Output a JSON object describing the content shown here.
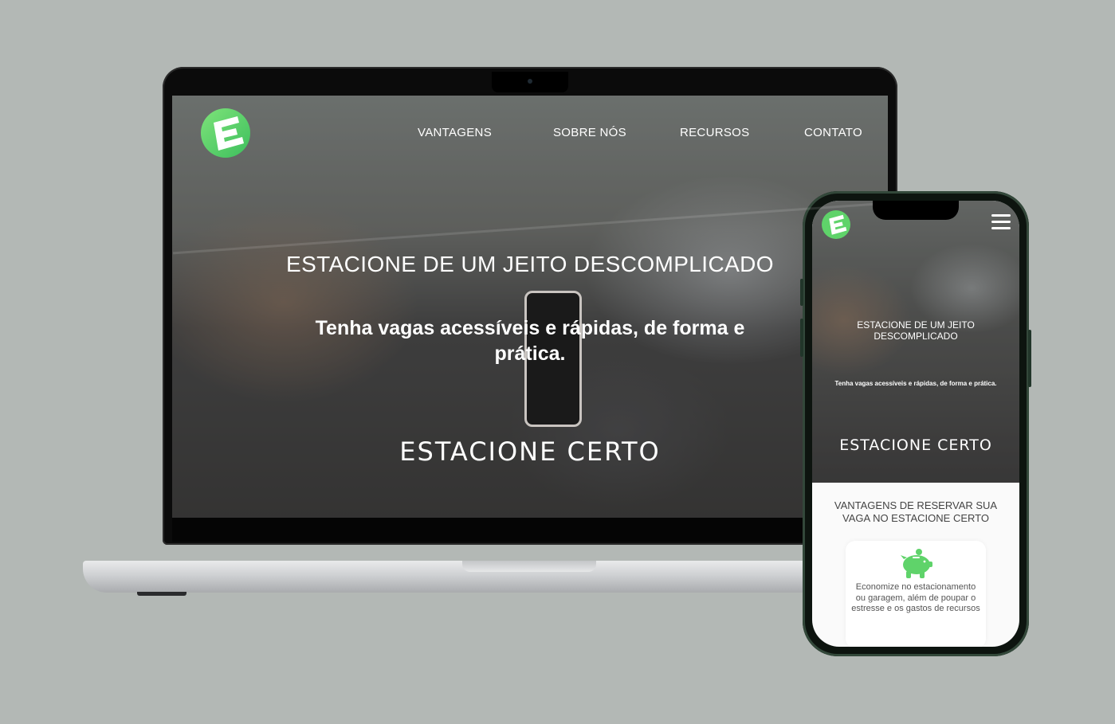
{
  "desktop": {
    "nav": {
      "items": [
        "VANTAGENS",
        "SOBRE NÓS",
        "RECURSOS",
        "CONTATO"
      ]
    },
    "hero": {
      "title": "ESTACIONE DE UM JEITO DESCOMPLICADO",
      "subtitle": "Tenha vagas acessíveis e rápidas, de forma e prática.",
      "brand": "ESTACIONE CERTO"
    }
  },
  "mobile": {
    "hero": {
      "title": "ESTACIONE DE UM JEITO DESCOMPLICADO",
      "subtitle": "Tenha vagas acessíveis e rápidas, de forma e prática.",
      "brand": "ESTACIONE CERTO"
    },
    "advantages": {
      "title": "VANTAGENS DE RESERVAR SUA VAGA NO ESTACIONE CERTO",
      "cards": [
        {
          "icon": "piggy-bank-icon",
          "text": "Economize no estacionamento ou garagem, além de poupar o estresse e os gastos de recursos"
        }
      ]
    }
  },
  "colors": {
    "brand_green": "#5fd36a",
    "background": "#b3b8b5"
  }
}
